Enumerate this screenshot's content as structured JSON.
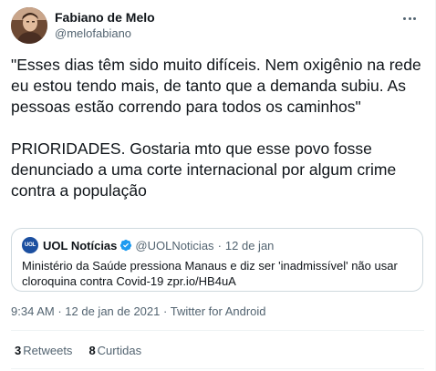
{
  "author": {
    "name": "Fabiano de Melo",
    "handle": "@melofabiano",
    "avatar_icon": "profile-photo"
  },
  "tweet": {
    "text": "\"Esses dias têm sido muito difíceis. Nem oxigênio na rede eu estou tendo mais, de tanto que a demanda subiu. As pessoas estão correndo para todos os caminhos\"\n\nPRIORIDADES. Gostaria mto que esse povo fosse denunciado a uma corte internacional por algum crime contra a população"
  },
  "quote": {
    "name": "UOL Notícias",
    "handle": "@UOLNoticias",
    "date": "12 de jan",
    "logo_text": "UOL",
    "verified": true,
    "text": "Ministério da Saúde pressiona Manaus e diz ser 'inadmissível' não usar cloroquina contra Covid-19 zpr.io/HB4uA"
  },
  "meta": {
    "time": "9:34 AM",
    "date": "12 de jan de 2021",
    "source": "Twitter for Android"
  },
  "stats": {
    "retweets_count": "3",
    "retweets_label": "Retweets",
    "likes_count": "8",
    "likes_label": "Curtidas"
  },
  "colors": {
    "text": "#0f1419",
    "secondary": "#536471",
    "verified": "#1d9bf0",
    "uol_brand": "#1b4fa0",
    "border": "#cfd9de"
  }
}
